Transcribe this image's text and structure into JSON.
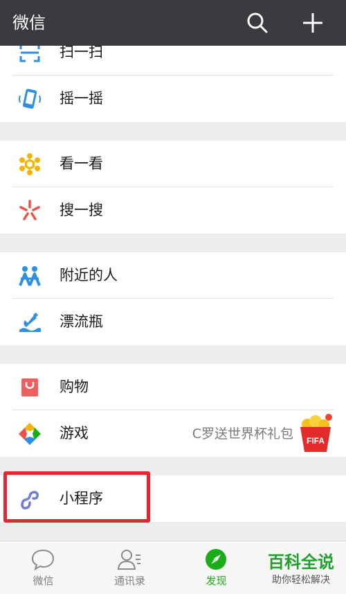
{
  "header": {
    "title": "微信"
  },
  "discover": {
    "items": [
      {
        "label": "扫一扫"
      },
      {
        "label": "摇一摇"
      },
      {
        "label": "看一看"
      },
      {
        "label": "搜一搜"
      },
      {
        "label": "附近的人"
      },
      {
        "label": "漂流瓶"
      },
      {
        "label": "购物"
      },
      {
        "label": "游戏",
        "promo": "C罗送世界杯礼包",
        "badge_text": "FIFA"
      },
      {
        "label": "小程序"
      }
    ]
  },
  "tabs": [
    {
      "label": "微信"
    },
    {
      "label": "通讯录"
    },
    {
      "label": "发现",
      "active": true
    }
  ],
  "watermark": {
    "line1": "百科全说",
    "line2": "助你轻松解决"
  },
  "colors": {
    "topbar": "#3a3a3f",
    "accent_green": "#1aad19",
    "highlight_red": "#e3262f"
  }
}
